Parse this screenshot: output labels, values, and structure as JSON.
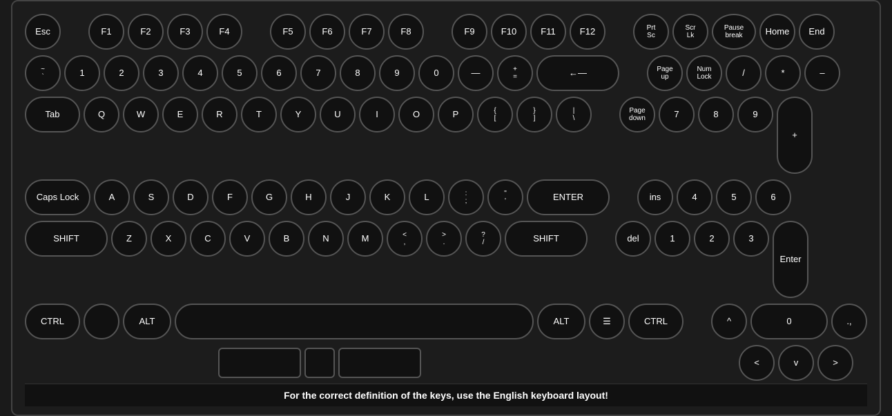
{
  "keyboard": {
    "status_bar": "For the correct definition of the keys, use the English keyboard layout!",
    "rows": [
      {
        "id": "function-row",
        "keys": [
          {
            "id": "esc",
            "label": "Esc",
            "width": "w-esc"
          },
          {
            "id": "gap1",
            "label": "",
            "width": "w-gap"
          },
          {
            "id": "f1",
            "label": "F1",
            "width": "w-fn"
          },
          {
            "id": "f2",
            "label": "F2",
            "width": "w-fn"
          },
          {
            "id": "f3",
            "label": "F3",
            "width": "w-fn"
          },
          {
            "id": "f4",
            "label": "F4",
            "width": "w-fn"
          },
          {
            "id": "gap2",
            "label": "",
            "width": "w-gap"
          },
          {
            "id": "f5",
            "label": "F5",
            "width": "w-fn"
          },
          {
            "id": "f6",
            "label": "F6",
            "width": "w-fn"
          },
          {
            "id": "f7",
            "label": "F7",
            "width": "w-fn"
          },
          {
            "id": "f8",
            "label": "F8",
            "width": "w-fn"
          },
          {
            "id": "gap3",
            "label": "",
            "width": "w-gap"
          },
          {
            "id": "f9",
            "label": "F9",
            "width": "w-fn"
          },
          {
            "id": "f10",
            "label": "F10",
            "width": "w-fn"
          },
          {
            "id": "f11",
            "label": "F11",
            "width": "w-fn"
          },
          {
            "id": "f12",
            "label": "F12",
            "width": "w-fn"
          },
          {
            "id": "gap4",
            "label": "",
            "width": "w-gap"
          },
          {
            "id": "prtsc",
            "label": "Prt\nSc",
            "width": "w-fn",
            "multiline": true,
            "line1": "Prt",
            "line2": "Sc"
          },
          {
            "id": "scrlk",
            "label": "Scr\nLk",
            "width": "w-fn",
            "multiline": true,
            "line1": "Scr",
            "line2": "Lk"
          },
          {
            "id": "pause",
            "label": "Pause\nbreak",
            "width": "w-fn",
            "multiline": true,
            "line1": "Pause",
            "line2": "break"
          },
          {
            "id": "home",
            "label": "Home",
            "width": "w-fn"
          },
          {
            "id": "end",
            "label": "End",
            "width": "w-fn"
          }
        ]
      },
      {
        "id": "number-row",
        "keys": [
          {
            "id": "backtick",
            "label": "~\n`",
            "width": "w-fn",
            "multiline": true,
            "line1": "~",
            "line2": "`"
          },
          {
            "id": "1",
            "label": "1",
            "width": "w-fn"
          },
          {
            "id": "2",
            "label": "2",
            "width": "w-fn"
          },
          {
            "id": "3",
            "label": "3",
            "width": "w-fn"
          },
          {
            "id": "4",
            "label": "4",
            "width": "w-fn"
          },
          {
            "id": "5",
            "label": "5",
            "width": "w-fn"
          },
          {
            "id": "6",
            "label": "6",
            "width": "w-fn"
          },
          {
            "id": "7",
            "label": "7",
            "width": "w-fn"
          },
          {
            "id": "8",
            "label": "8",
            "width": "w-fn"
          },
          {
            "id": "9",
            "label": "9",
            "width": "w-fn"
          },
          {
            "id": "0",
            "label": "0",
            "width": "w-fn"
          },
          {
            "id": "minus",
            "label": "—",
            "width": "w-fn"
          },
          {
            "id": "equals",
            "label": "+ =",
            "width": "w-fn",
            "multiline": true,
            "line1": "+",
            "line2": "="
          },
          {
            "id": "backspace",
            "label": "←—",
            "width": "w-backspace"
          },
          {
            "id": "gap5",
            "label": "",
            "width": "w-gap"
          },
          {
            "id": "pageup",
            "label": "Page\nup",
            "width": "w-fn",
            "multiline": true,
            "line1": "Page",
            "line2": "up"
          },
          {
            "id": "numlk",
            "label": "Num\nLock",
            "width": "w-fn",
            "multiline": true,
            "line1": "Num",
            "line2": "Lock"
          },
          {
            "id": "numslash",
            "label": "/",
            "width": "w-fn"
          },
          {
            "id": "numstar",
            "label": "*",
            "width": "w-fn"
          },
          {
            "id": "numminus",
            "label": "–",
            "width": "w-fn"
          }
        ]
      },
      {
        "id": "qwerty-row",
        "keys": [
          {
            "id": "tab",
            "label": "Tab",
            "width": "w-tab"
          },
          {
            "id": "q",
            "label": "Q",
            "width": "w-fn"
          },
          {
            "id": "w",
            "label": "W",
            "width": "w-fn"
          },
          {
            "id": "e",
            "label": "E",
            "width": "w-fn"
          },
          {
            "id": "r",
            "label": "R",
            "width": "w-fn"
          },
          {
            "id": "t",
            "label": "T",
            "width": "w-fn"
          },
          {
            "id": "y",
            "label": "Y",
            "width": "w-fn"
          },
          {
            "id": "u",
            "label": "U",
            "width": "w-fn"
          },
          {
            "id": "i",
            "label": "I",
            "width": "w-fn"
          },
          {
            "id": "o",
            "label": "O",
            "width": "w-fn"
          },
          {
            "id": "p",
            "label": "P",
            "width": "w-fn"
          },
          {
            "id": "lbracket",
            "label": "{\n[",
            "width": "w-fn",
            "multiline": true,
            "line1": "{",
            "line2": "["
          },
          {
            "id": "rbracket",
            "label": "}\n]",
            "width": "w-fn",
            "multiline": true,
            "line1": "}",
            "line2": "]"
          },
          {
            "id": "backslash",
            "label": "|\n\\",
            "width": "w-fn",
            "multiline": true,
            "line1": "|",
            "line2": "\\"
          },
          {
            "id": "gap6",
            "label": "",
            "width": "w-gap"
          },
          {
            "id": "pagedown",
            "label": "Page\ndown",
            "width": "w-fn",
            "multiline": true,
            "line1": "Page",
            "line2": "down"
          },
          {
            "id": "num7",
            "label": "7",
            "width": "w-fn"
          },
          {
            "id": "num8",
            "label": "8",
            "width": "w-fn"
          },
          {
            "id": "num9",
            "label": "9",
            "width": "w-fn"
          },
          {
            "id": "numplus",
            "label": "+",
            "width": "w-fn",
            "tall": true
          }
        ]
      },
      {
        "id": "asdf-row",
        "keys": [
          {
            "id": "caps",
            "label": "Caps Lock",
            "width": "w-caps"
          },
          {
            "id": "a",
            "label": "A",
            "width": "w-fn"
          },
          {
            "id": "s",
            "label": "S",
            "width": "w-fn"
          },
          {
            "id": "d",
            "label": "D",
            "width": "w-fn"
          },
          {
            "id": "f",
            "label": "F",
            "width": "w-fn"
          },
          {
            "id": "g",
            "label": "G",
            "width": "w-fn"
          },
          {
            "id": "h",
            "label": "H",
            "width": "w-fn"
          },
          {
            "id": "j",
            "label": "J",
            "width": "w-fn"
          },
          {
            "id": "k",
            "label": "K",
            "width": "w-fn"
          },
          {
            "id": "l",
            "label": "L",
            "width": "w-fn"
          },
          {
            "id": "semicolon",
            "label": ":\n;",
            "width": "w-fn",
            "multiline": true,
            "line1": ":",
            "line2": ";"
          },
          {
            "id": "quote",
            "label": "\"\n'",
            "width": "w-fn",
            "multiline": true,
            "line1": "\"",
            "line2": "'"
          },
          {
            "id": "enter",
            "label": "ENTER",
            "width": "w-enter"
          },
          {
            "id": "gap7",
            "label": "",
            "width": "w-gap"
          },
          {
            "id": "ins",
            "label": "ins",
            "width": "w-fn"
          },
          {
            "id": "num4",
            "label": "4",
            "width": "w-fn"
          },
          {
            "id": "num5",
            "label": "5",
            "width": "w-fn"
          },
          {
            "id": "num6",
            "label": "6",
            "width": "w-fn"
          }
        ]
      },
      {
        "id": "zxcv-row",
        "keys": [
          {
            "id": "shiftl",
            "label": "SHIFT",
            "width": "w-shift-l"
          },
          {
            "id": "z",
            "label": "Z",
            "width": "w-fn"
          },
          {
            "id": "x",
            "label": "X",
            "width": "w-fn"
          },
          {
            "id": "c",
            "label": "C",
            "width": "w-fn"
          },
          {
            "id": "v",
            "label": "V",
            "width": "w-fn"
          },
          {
            "id": "b",
            "label": "B",
            "width": "w-fn"
          },
          {
            "id": "n",
            "label": "N",
            "width": "w-fn"
          },
          {
            "id": "m",
            "label": "M",
            "width": "w-fn"
          },
          {
            "id": "comma",
            "label": "<\n,",
            "width": "w-fn",
            "multiline": true,
            "line1": "<",
            "line2": ","
          },
          {
            "id": "period",
            "label": ">\n.",
            "width": "w-fn",
            "multiline": true,
            "line1": ">",
            "line2": "."
          },
          {
            "id": "slash",
            "label": "?\n/",
            "width": "w-fn",
            "multiline": true,
            "line1": "?",
            "line2": "/"
          },
          {
            "id": "shiftr",
            "label": "SHIFT",
            "width": "w-shift-r"
          },
          {
            "id": "gap8",
            "label": "",
            "width": "w-gap"
          },
          {
            "id": "del",
            "label": "del",
            "width": "w-fn"
          },
          {
            "id": "num1",
            "label": "1",
            "width": "w-fn"
          },
          {
            "id": "num2",
            "label": "2",
            "width": "w-fn"
          },
          {
            "id": "num3",
            "label": "3",
            "width": "w-fn"
          },
          {
            "id": "numenter",
            "label": "Enter",
            "width": "w-fn",
            "tall": true
          }
        ]
      },
      {
        "id": "bottom-row",
        "keys": [
          {
            "id": "ctrll",
            "label": "CTRL",
            "width": "w-ctrl"
          },
          {
            "id": "winl",
            "label": "",
            "width": "w-win"
          },
          {
            "id": "altl",
            "label": "ALT",
            "width": "w-alt"
          },
          {
            "id": "space",
            "label": "",
            "width": "w-space"
          },
          {
            "id": "altr",
            "label": "ALT",
            "width": "w-alt"
          },
          {
            "id": "menu",
            "label": "☰",
            "width": "w-menu"
          },
          {
            "id": "ctrlr",
            "label": "CTRL",
            "width": "w-ctrl"
          },
          {
            "id": "gap9",
            "label": "",
            "width": "w-gap"
          },
          {
            "id": "numcaret",
            "label": "^",
            "width": "w-fn"
          },
          {
            "id": "num0",
            "label": "0",
            "width": "w-num0"
          },
          {
            "id": "numdot",
            "label": ".,",
            "width": "w-fn"
          }
        ]
      }
    ]
  }
}
